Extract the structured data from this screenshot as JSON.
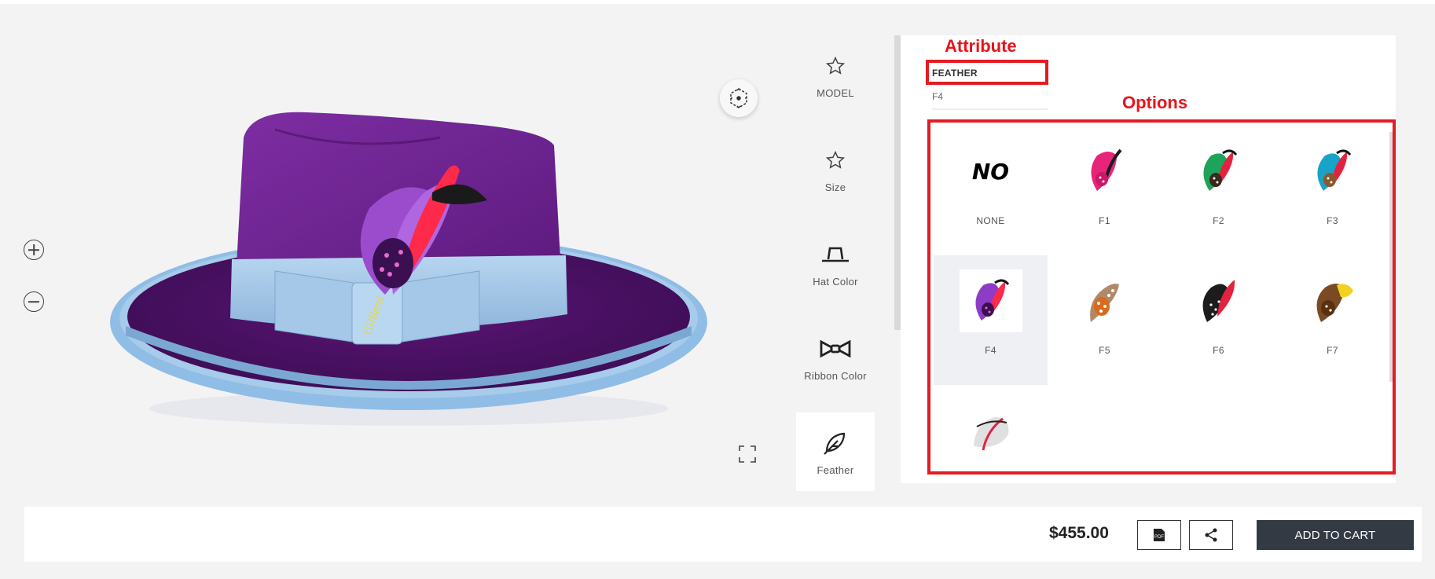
{
  "tabs": [
    {
      "label": "MODEL",
      "icon": "star-icon"
    },
    {
      "label": "Size",
      "icon": "star-icon"
    },
    {
      "label": "Hat Color",
      "icon": "hat-icon"
    },
    {
      "label": "Ribbon Color",
      "icon": "bowtie-icon"
    },
    {
      "label": "Feather",
      "icon": "feather-icon"
    }
  ],
  "annotations": {
    "attribute_title": "Attribute",
    "options_title": "Options"
  },
  "attribute": {
    "name": "FEATHER",
    "value": "F4"
  },
  "options": [
    {
      "label": "NONE",
      "thumb_text": "NO"
    },
    {
      "label": "F1"
    },
    {
      "label": "F2"
    },
    {
      "label": "F3"
    },
    {
      "label": "F4",
      "selected": true
    },
    {
      "label": "F5"
    },
    {
      "label": "F6"
    },
    {
      "label": "F7"
    },
    {
      "label": ""
    }
  ],
  "price": "$455.00",
  "add_to_cart_label": "ADD TO CART",
  "colors": {
    "hat_purple": "#6b1f8c",
    "ribbon_blue": "#9cc3e6",
    "annotation_red": "#e31b23",
    "cart_button": "#333a44"
  }
}
